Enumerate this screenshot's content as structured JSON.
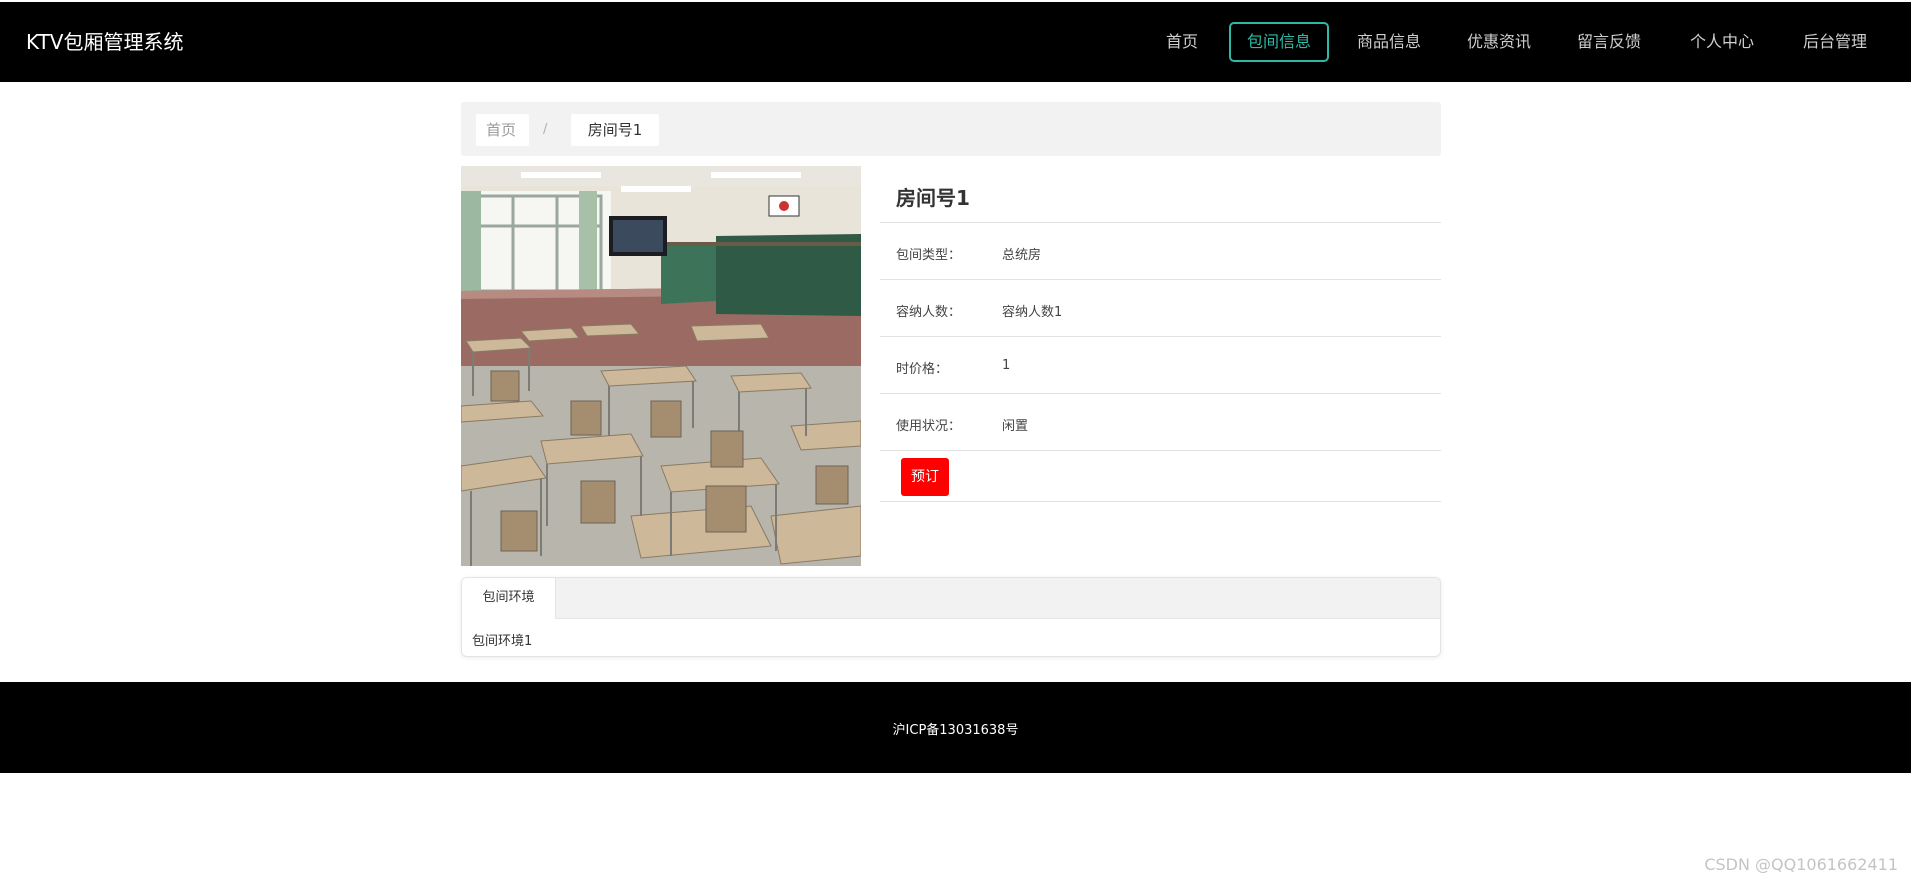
{
  "brand": "KTV包厢管理系统",
  "nav": {
    "items": [
      {
        "label": "首页"
      },
      {
        "label": "包间信息",
        "active": true
      },
      {
        "label": "商品信息"
      },
      {
        "label": "优惠资讯"
      },
      {
        "label": "留言反馈"
      },
      {
        "label": "个人中心"
      },
      {
        "label": "后台管理"
      }
    ],
    "active_color": "#2fb8a5"
  },
  "breadcrumb": {
    "home": "首页",
    "separator": "/",
    "current": "房间号1"
  },
  "room": {
    "title": "房间号1",
    "fields": [
      {
        "label": "包间类型：",
        "value": "总统房"
      },
      {
        "label": "容纳人数：",
        "value": "容纳人数1"
      },
      {
        "label": "时价格：",
        "value": "1"
      },
      {
        "label": "使用状况：",
        "value": "闲置"
      }
    ],
    "book_button": "预订",
    "book_button_color": "#ff0000"
  },
  "tabs": {
    "items": [
      {
        "label": "包间环境"
      }
    ],
    "content": "包间环境1"
  },
  "footer": {
    "text": "沪ICP备13031638号"
  },
  "watermark": "CSDN @QQ1061662411"
}
